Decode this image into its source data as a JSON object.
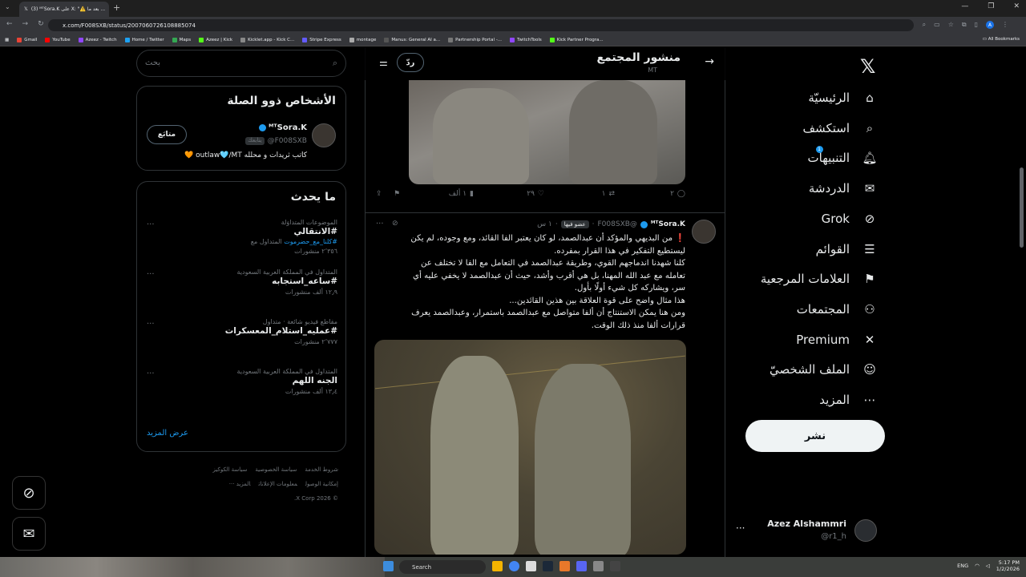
{
  "browser": {
    "tab_title": "(3) ᴹᵀSora.K على X: \"⚠️ بعد ما ...",
    "url": "x.com/F008SXB/status/2007060726108885074",
    "bookmarks": [
      "Gmail",
      "YouTube",
      "Azeez - Twitch",
      "Home / Twitter",
      "Maps",
      "Azeez | Kick",
      "Kicklet.app - Kick C...",
      "Stripe Express",
      "montage",
      "Manus: General AI a...",
      "Partnership Portal -...",
      "TwitchTools",
      "Kick Partner Progra..."
    ],
    "all_bookmarks": "All Bookmarks",
    "profile_initial": "A"
  },
  "nav": {
    "items": [
      {
        "label": "الرئيسيّة",
        "icon": "home-icon",
        "glyph": "⌂"
      },
      {
        "label": "استكشف",
        "icon": "search-icon",
        "glyph": "⌕"
      },
      {
        "label": "التنبيهات",
        "icon": "bell-icon",
        "glyph": "🔔︎"
      },
      {
        "label": "الدردشة",
        "icon": "mail-icon",
        "glyph": "✉"
      },
      {
        "label": "Grok",
        "icon": "grok-icon",
        "glyph": "⊘"
      },
      {
        "label": "القوائم",
        "icon": "list-icon",
        "glyph": "☰"
      },
      {
        "label": "العلامات المرجعية",
        "icon": "bookmark-icon",
        "glyph": "⚑"
      },
      {
        "label": "المجتمعات",
        "icon": "communities-icon",
        "glyph": "⚇"
      },
      {
        "label": "Premium",
        "icon": "x-premium-icon",
        "glyph": "✕"
      },
      {
        "label": "الملف الشخصيّ",
        "icon": "profile-icon",
        "glyph": "☺"
      },
      {
        "label": "المزيد",
        "icon": "more-icon",
        "glyph": "⋯"
      }
    ],
    "notif_count": "1",
    "post_label": "نشر",
    "account_name": "Azez Alshammri",
    "account_handle": "@r1_h"
  },
  "center": {
    "title": "منشور المجتمع",
    "subtitle": "MT",
    "reply_label": "ردّ",
    "actions": {
      "replies": "٢",
      "reposts": "١",
      "likes": "٢٩",
      "views": "١ ألف"
    },
    "tweet": {
      "name": "ᴹᵀSora.K",
      "handle": "@F008SXB",
      "badge": "عضو فيها",
      "time": "١ س",
      "lines": [
        "❗ من البديهي والمؤكد أن عبدالصمد، لو كان يعتبر الفا القائد، ومع وجوده، لم يكن",
        "ليستطيع التفكير في هذا القرار بمفرده.",
        "كلنا شهدنا اندماجهم القوي، وطريقة عبدالصمد في التعامل مع الفا لا تختلف عن",
        "تعامله مع عبد الله المهنا، بل هي أقرب وأشد، حيث أن عبدالصمد لا يخفي عليه أي",
        "سر، ويشاركه كل شيء أولًا بأول.",
        "هذا مثال واضح على قوة العلاقة بين هذين القائدين...",
        "ومن هنا يمكن الاستنتاج أن ألفا متواصل مع عبدالصمد باستمرار، وعبدالصمد يعرف",
        "قرارات ألفا منذ ذلك الوقت."
      ]
    }
  },
  "sidebar": {
    "search_placeholder": "بحث",
    "related_title": "الأشخاص ذوو الصلة",
    "person": {
      "name": "ᴹᵀSora.K",
      "handle": "@F008SXB",
      "follows_you": "يتابعك",
      "bio": "كاتب ثريدات و محلله outlaw🩵/MT 🧡",
      "follow_label": "متابَع"
    },
    "trending_title": "ما يحدث",
    "trends": [
      {
        "context": "الموضوعات المتداوَلة",
        "title": "#الانتقالي",
        "extra_tag": "#كلنا_مع_حضرموت",
        "extra_suffix": "المتداول مع",
        "count": "٢٬٣٥٦ منشورات"
      },
      {
        "context": "المتداول في المملكة العربية السعودية",
        "title": "#ساعه_استجابه",
        "extra_tag": "",
        "extra_suffix": "",
        "count": "١٢٫٩ ألف منشورات"
      },
      {
        "context": "مقاطع فيديو شائعة · متداول",
        "title": "#عمليه_استلام_المعسكرات",
        "extra_tag": "",
        "extra_suffix": "",
        "count": "٢٬٧٧٧ منشورات"
      },
      {
        "context": "المتداول في المملكة العربية السعودية",
        "title": "الجنه اللهم",
        "extra_tag": "",
        "extra_suffix": "",
        "count": "١٣٫٤ ألف منشورات"
      }
    ],
    "show_more": "عرض المزيد",
    "footer": [
      "شروط الخدمة",
      "سياسة الخصوصية",
      "سياسة الكوكيز",
      "إمكانية الوصول",
      "معلومات الإعلانات",
      "المزيد ···",
      "© 2026 X Corp."
    ]
  },
  "taskbar": {
    "search": "Search",
    "lang": "ENG",
    "time": "5:17 PM",
    "date": "1/2/2026"
  }
}
